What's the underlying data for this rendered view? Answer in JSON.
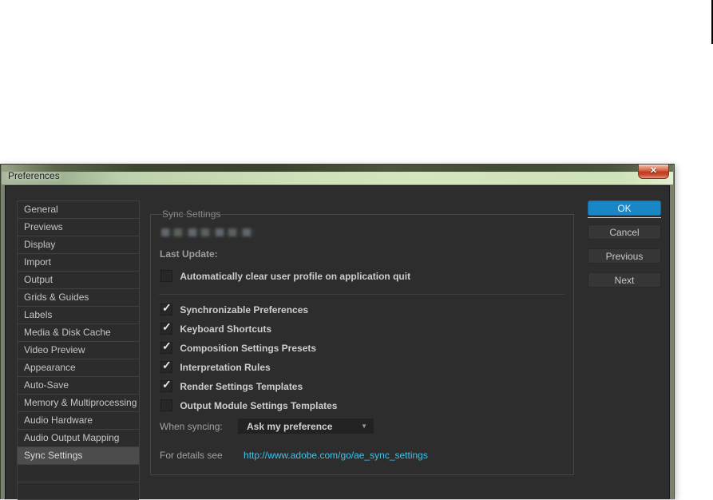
{
  "window": {
    "title": "Preferences",
    "close_glyph": "✕"
  },
  "sidebar": {
    "items": [
      {
        "label": "General",
        "selected": false
      },
      {
        "label": "Previews",
        "selected": false
      },
      {
        "label": "Display",
        "selected": false
      },
      {
        "label": "Import",
        "selected": false
      },
      {
        "label": "Output",
        "selected": false
      },
      {
        "label": "Grids & Guides",
        "selected": false
      },
      {
        "label": "Labels",
        "selected": false
      },
      {
        "label": "Media & Disk Cache",
        "selected": false
      },
      {
        "label": "Video Preview",
        "selected": false
      },
      {
        "label": "Appearance",
        "selected": false
      },
      {
        "label": "Auto-Save",
        "selected": false
      },
      {
        "label": "Memory & Multiprocessing",
        "selected": false
      },
      {
        "label": "Audio Hardware",
        "selected": false
      },
      {
        "label": "Audio Output Mapping",
        "selected": false
      },
      {
        "label": "Sync Settings",
        "selected": true
      }
    ]
  },
  "panel": {
    "group_title": "Sync Settings",
    "last_update_label": "Last Update:",
    "clear_profile": {
      "label": "Automatically clear user profile on application quit",
      "checked": false,
      "mark": ""
    },
    "sync_items": [
      {
        "label": "Synchronizable Preferences",
        "checked": true,
        "mark": "✓"
      },
      {
        "label": "Keyboard Shortcuts",
        "checked": true,
        "mark": "✓"
      },
      {
        "label": "Composition Settings Presets",
        "checked": true,
        "mark": "✓"
      },
      {
        "label": "Interpretation Rules",
        "checked": true,
        "mark": "✓"
      },
      {
        "label": "Render Settings Templates",
        "checked": true,
        "mark": "✓"
      },
      {
        "label": "Output Module Settings Templates",
        "checked": false,
        "mark": ""
      }
    ],
    "when_syncing_label": "When syncing:",
    "when_syncing_value": "Ask my preference",
    "dropdown_arrow": "▼",
    "details_label": "For details see",
    "details_link": "http://www.adobe.com/go/ae_sync_settings"
  },
  "buttons": {
    "ok": "OK",
    "cancel": "Cancel",
    "previous": "Previous",
    "next": "Next"
  },
  "colors": {
    "accent_blue": "#1987c5",
    "link_cyan": "#3fc3e8",
    "selected_row": "#4c4c4c",
    "panel_bg": "#2d2d2d"
  }
}
